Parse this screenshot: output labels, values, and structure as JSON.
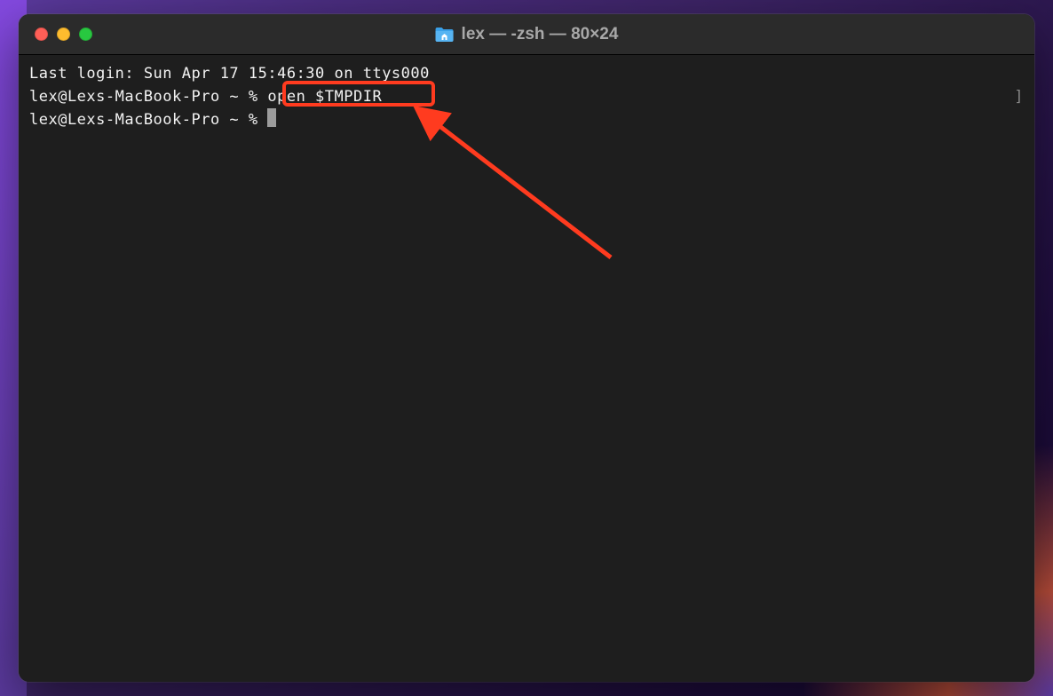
{
  "window": {
    "title": "lex — -zsh — 80×24"
  },
  "colors": {
    "highlight": "#ff3b1f",
    "terminal_bg": "#1e1e1e",
    "titlebar_bg": "#2b2b2b",
    "text": "#f2f2f2"
  },
  "terminal": {
    "last_login": "Last login: Sun Apr 17 15:46:30 on ttys000",
    "prompt1_prefix": "lex@Lexs-MacBook-Pro ~ % ",
    "command1": "open $TMPDIR",
    "prompt2": "lex@Lexs-MacBook-Pro ~ % "
  },
  "annotation": {
    "highlight_target": "open $TMPDIR"
  }
}
